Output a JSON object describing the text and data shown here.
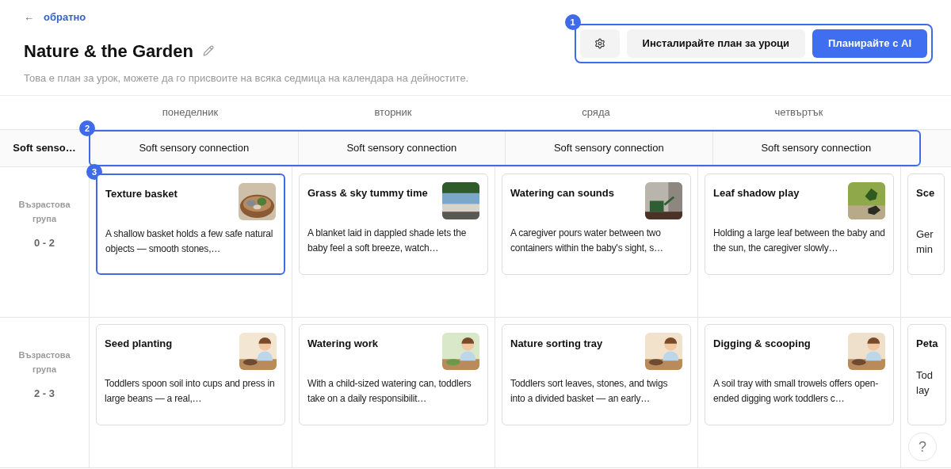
{
  "back_link": {
    "arrow": "←",
    "label": "обратно"
  },
  "title": "Nature & the Garden",
  "subtitle": "Това е план за урок, можете да го присвоите на всяка седмица на календара на дейностите.",
  "actions": {
    "badge": "1",
    "buttons": [
      {
        "kind": "settings"
      },
      {
        "kind": "secondary",
        "label": "Инсталирайте план за уроци"
      },
      {
        "kind": "primary",
        "label": "Планирайте с AI"
      }
    ]
  },
  "days": [
    "понеделник",
    "вторник",
    "сряда",
    "четвъртък"
  ],
  "theme_row": {
    "label": "Soft senso…",
    "badge": "2",
    "themes": [
      "Soft sensory connection",
      "Soft sensory connection",
      "Soft sensory connection",
      "Soft sensory connection"
    ]
  },
  "rows": [
    {
      "group_label": "Възрастова група",
      "age": "0 - 2",
      "cards": [
        {
          "title": "Texture basket",
          "description": "A shallow basket holds a few safe natural objects — smooth stones,…",
          "selected": true,
          "badge": "3"
        },
        {
          "title": "Grass & sky tummy time",
          "description": "A blanket laid in dappled shade lets the baby feel a soft breeze, watch…",
          "selected": false
        },
        {
          "title": "Watering can sounds",
          "description": "A caregiver pours water between two containers within the baby's sight, s…",
          "selected": false
        },
        {
          "title": "Leaf shadow play",
          "description": "Holding a large leaf between the baby and the sun, the caregiver slowly…",
          "selected": false
        },
        {
          "title": "Sce",
          "description_lines": [
            "Ger",
            "min"
          ],
          "selected": false
        }
      ]
    },
    {
      "group_label": "Възрастова група",
      "age": "2 - 3",
      "cards": [
        {
          "title": "Seed planting",
          "description": "Toddlers spoon soil into cups and press in large beans — a real,…",
          "selected": false
        },
        {
          "title": "Watering work",
          "description": "With a child-sized watering can, toddlers take on a daily responsibilit…",
          "selected": false
        },
        {
          "title": "Nature sorting tray",
          "description": "Toddlers sort leaves, stones, and twigs into a divided basket — an early…",
          "selected": false
        },
        {
          "title": "Digging & scooping",
          "description": "A soil tray with small trowels offers open-ended digging work toddlers c…",
          "selected": false
        },
        {
          "title": "Peta",
          "description_lines": [
            "Tod",
            "lay"
          ],
          "selected": false
        }
      ]
    }
  ],
  "help_button": {
    "label": "?"
  }
}
